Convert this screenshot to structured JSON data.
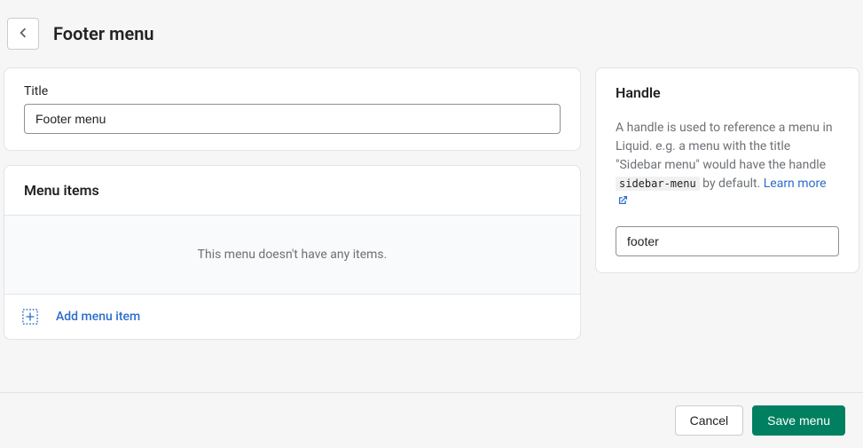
{
  "header": {
    "page_title": "Footer menu"
  },
  "title_card": {
    "label": "Title",
    "value": "Footer menu"
  },
  "menu_items": {
    "heading": "Menu items",
    "empty_message": "This menu doesn't have any items.",
    "add_label": "Add menu item"
  },
  "handle": {
    "heading": "Handle",
    "desc_prefix": "A handle is used to reference a menu in Liquid. e.g. a menu with the title \"Sidebar menu\" would have the handle ",
    "code_example": "sidebar-menu",
    "desc_suffix": " by default. ",
    "learn_more": "Learn more",
    "value": "footer"
  },
  "footer": {
    "cancel": "Cancel",
    "save": "Save menu"
  }
}
